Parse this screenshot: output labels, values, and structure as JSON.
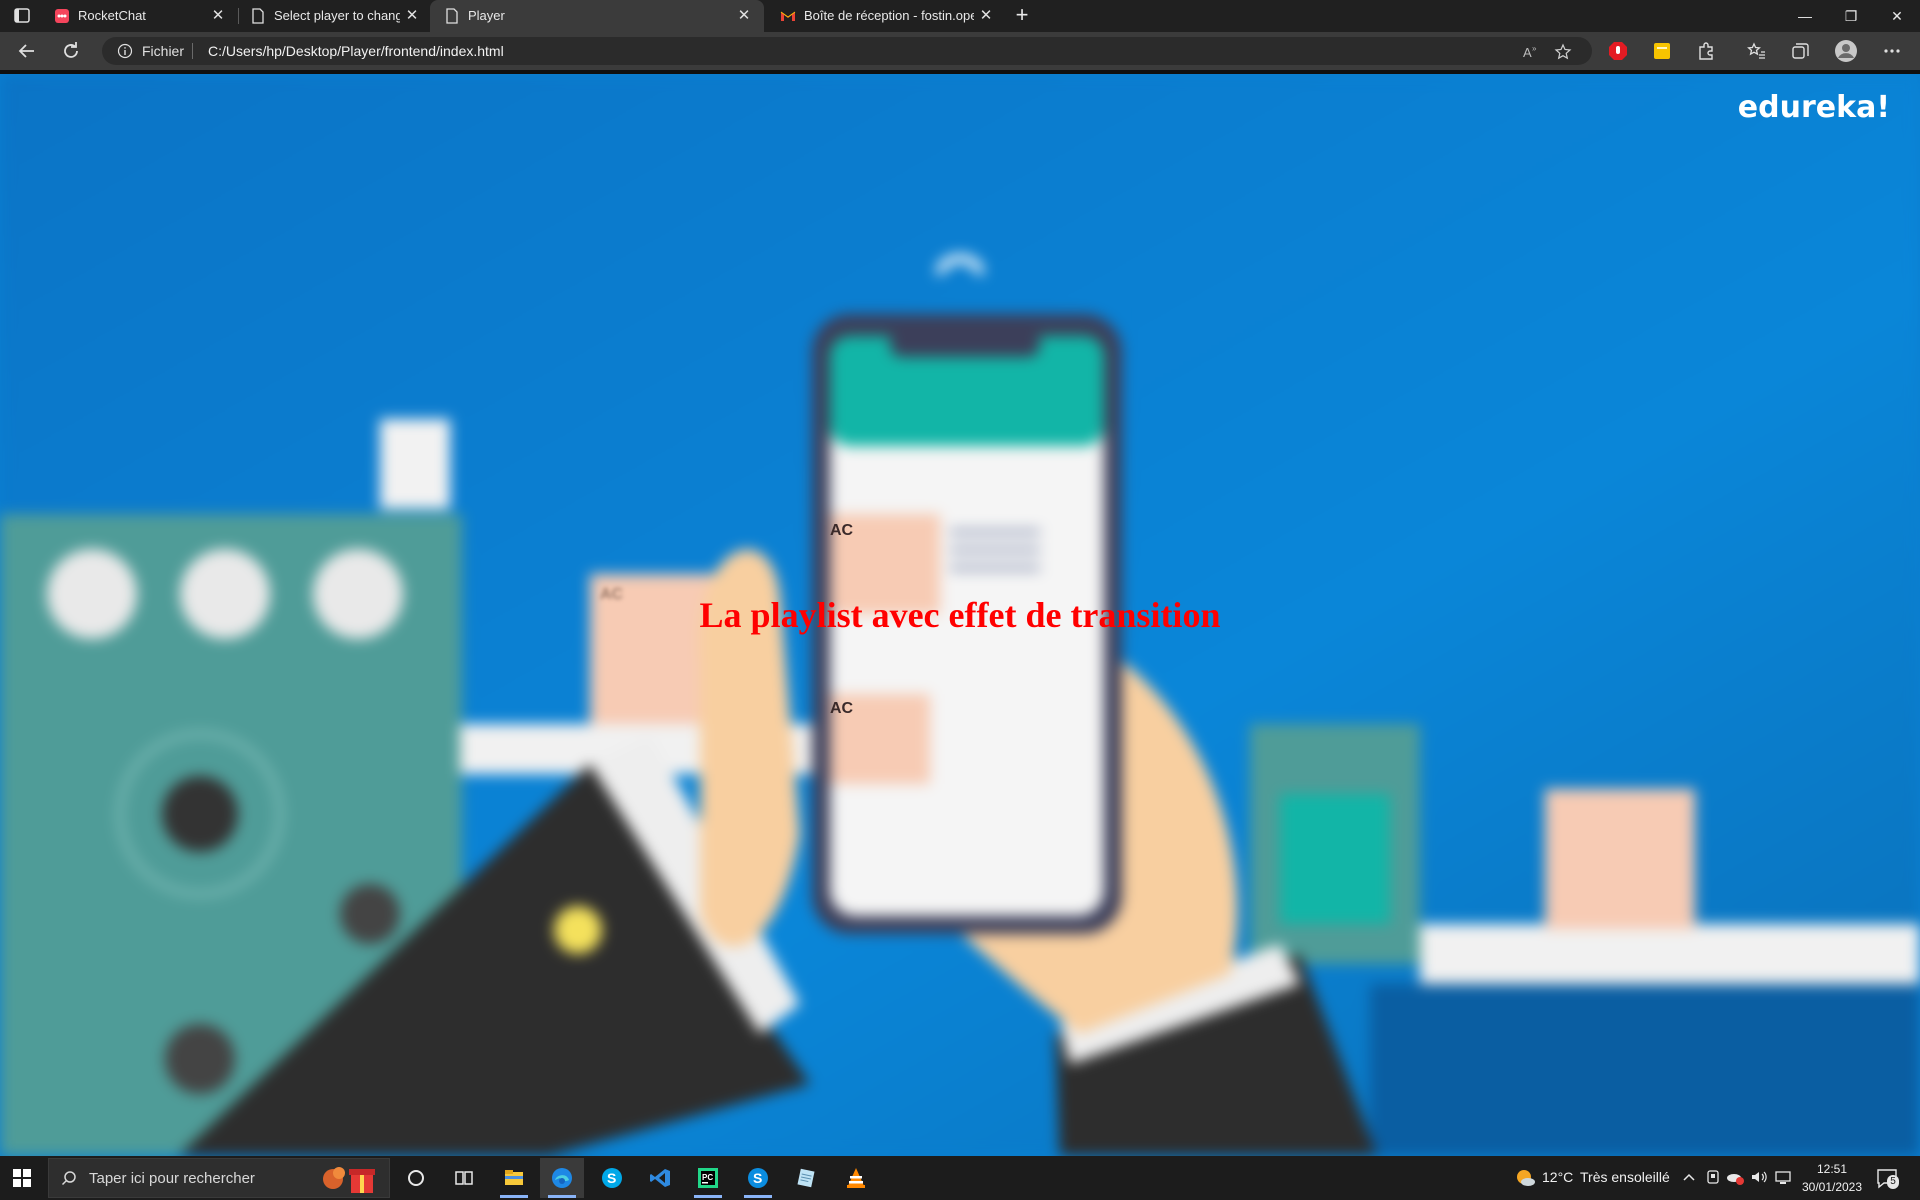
{
  "browser": {
    "tabs": [
      {
        "title": "RocketChat",
        "icon": "rocketchat-icon",
        "active": false
      },
      {
        "title": "Select player to change | Django",
        "icon": "page-icon",
        "active": false
      },
      {
        "title": "Player",
        "icon": "page-icon",
        "active": true
      },
      {
        "title": "Boîte de réception - fostin.opens",
        "icon": "gmail-icon",
        "active": false
      }
    ],
    "new_tab_label": "+",
    "address": {
      "scheme_label": "Fichier",
      "url": "C:/Users/hp/Desktop/Player/frontend/index.html"
    }
  },
  "page": {
    "brand_logo_text": "edureka!",
    "overlay_title": "La playlist avec effet de transition",
    "video_frame_labels": [
      "AC",
      "AC",
      "AC"
    ],
    "colors": {
      "background": "#0a7fd1",
      "title": "#ff0000",
      "phone_header": "#12b5a7",
      "factory_panel": "#4f9c98"
    }
  },
  "taskbar": {
    "search_placeholder": "Taper ici pour rechercher",
    "apps": [
      "cortana-icon",
      "task-view-icon",
      "file-explorer-icon",
      "edge-icon",
      "skype-icon",
      "vscode-icon",
      "pycharm-icon",
      "skype-icon",
      "notepad-icon",
      "vlc-icon"
    ],
    "weather": {
      "temperature": "12°C",
      "condition": "Très ensoleillé"
    },
    "clock": {
      "time": "12:51",
      "date": "30/01/2023"
    },
    "notification_count": "5"
  }
}
